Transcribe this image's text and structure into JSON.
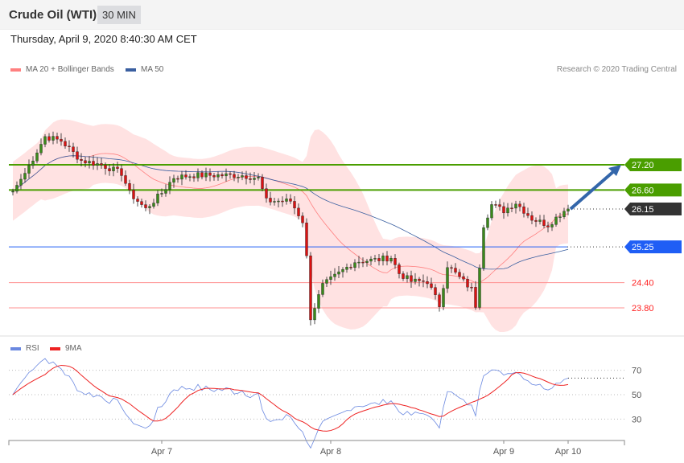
{
  "header": {
    "title": "Crude Oil (WTI)",
    "timeframe": "30 MIN"
  },
  "date": "Thursday, April 9, 2020 8:40:30 AM CET",
  "legend": {
    "ma20": "MA 20 + Bollinger Bands",
    "ma50": "MA 50",
    "rsi": "RSI",
    "ma9": "9MA"
  },
  "copyright": "Research © 2020 Trading Central",
  "colors": {
    "resist": "#4a9e00",
    "last": "#333333",
    "support_ma": "#1f5ef5",
    "support": "#ff2020",
    "ma20": "#ff8080",
    "ma50": "#3a5fa0",
    "rsi": "#6a88e0",
    "ma9": "#ee2222"
  },
  "chart_data": {
    "type": "candlestick",
    "levels": [
      {
        "label": "27.20",
        "value": 27.2,
        "kind": "resist"
      },
      {
        "label": "26.60",
        "value": 26.6,
        "kind": "resist"
      },
      {
        "label": "26.15",
        "value": 26.15,
        "kind": "last"
      },
      {
        "label": "25.25",
        "value": 25.25,
        "kind": "support_ma"
      },
      {
        "label": "24.40",
        "value": 24.4,
        "kind": "support"
      },
      {
        "label": "23.80",
        "value": 23.8,
        "kind": "support"
      }
    ],
    "close_anchors": [
      [
        0,
        26.57
      ],
      [
        3,
        27.0
      ],
      [
        8,
        27.87
      ],
      [
        12,
        27.77
      ],
      [
        17,
        27.3
      ],
      [
        22,
        27.2
      ],
      [
        27,
        27.0
      ],
      [
        29,
        26.53
      ],
      [
        33,
        26.15
      ],
      [
        37,
        26.53
      ],
      [
        40,
        26.9
      ],
      [
        45,
        26.95
      ],
      [
        51,
        26.95
      ],
      [
        57,
        26.95
      ],
      [
        61,
        26.88
      ],
      [
        63,
        26.34
      ],
      [
        69,
        26.34
      ],
      [
        72,
        25.86
      ],
      [
        73,
        25.0
      ],
      [
        74,
        23.57
      ],
      [
        77,
        24.33
      ],
      [
        81,
        24.62
      ],
      [
        85,
        24.9
      ],
      [
        91,
        24.95
      ],
      [
        94,
        25.0
      ],
      [
        96,
        24.62
      ],
      [
        99,
        24.43
      ],
      [
        103,
        24.43
      ],
      [
        106,
        23.86
      ],
      [
        108,
        24.81
      ],
      [
        111,
        24.52
      ],
      [
        114,
        24.24
      ],
      [
        115,
        23.86
      ],
      [
        117,
        25.77
      ],
      [
        119,
        26.25
      ],
      [
        122,
        26.11
      ],
      [
        125,
        26.3
      ],
      [
        129,
        25.92
      ],
      [
        133,
        25.77
      ],
      [
        137,
        26.11
      ],
      [
        138,
        26.15
      ]
    ],
    "x_ticks": [
      {
        "label": "Apr 7",
        "index": 37
      },
      {
        "label": "Apr 8",
        "index": 79
      },
      {
        "label": "Apr 9",
        "index": 122
      },
      {
        "label": "Apr 10",
        "index": 138
      }
    ],
    "rsi_ticks": [
      {
        "label": "70",
        "value": 70
      },
      {
        "label": "50",
        "value": 50
      },
      {
        "label": "30",
        "value": 30
      }
    ],
    "forecast_target": 27.2
  }
}
